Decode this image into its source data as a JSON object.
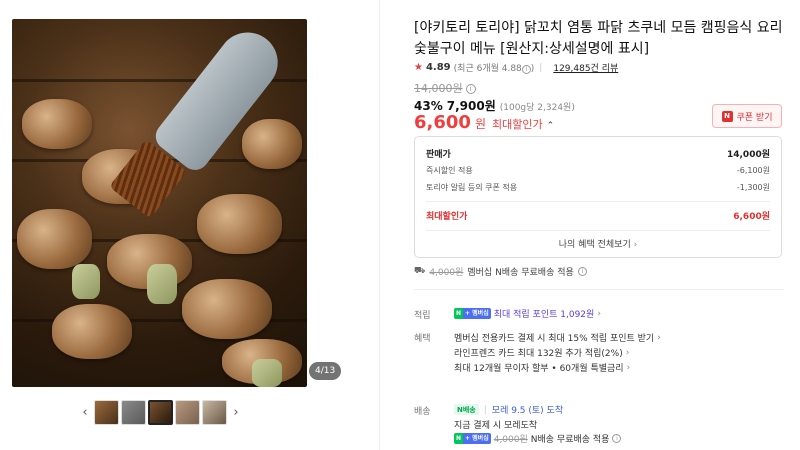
{
  "gallery": {
    "counter": "4/13",
    "prev_arrow": "‹",
    "next_arrow": "›",
    "thumbnails": [
      "thumb-1",
      "thumb-2",
      "thumb-3",
      "thumb-4",
      "thumb-5"
    ],
    "active_thumbnail": 3
  },
  "product": {
    "title": "[야키토리 토리야] 닭꼬치 염통 파닭 츠쿠네 모듬 캠핑음식 요리 숯불구이 메뉴 [원산지:상세설명에 표시]",
    "rating": "4.89",
    "rating_recent": "(최근 6개월 4.88",
    "rating_recent_close": ")",
    "review_count": "129,485건 리뷰",
    "original_price": "14,000원",
    "discount_rate": "43%",
    "discount_price": "7,900원",
    "unit_price": "(100g당 2,324원)",
    "final_price": "6,600",
    "final_unit": "원",
    "final_label": "최대할인가",
    "coupon_label": "쿠폰 받기"
  },
  "price_breakdown": {
    "sale_label": "판매가",
    "sale_value": "14,000원",
    "instant_label": "즉시할인 적용",
    "instant_value": "-6,100원",
    "coupon_label": "토리야 알림 등의 쿠폰 적용",
    "coupon_value": "-1,300원",
    "max_label": "최대할인가",
    "max_value": "6,600원",
    "more_label": "나의 혜택 전체보기"
  },
  "shipping": {
    "struck_fee": "4,000원",
    "text": "멤버십 N배송 무료배송 적용"
  },
  "benefits": {
    "points_label": "적립",
    "points_text": "최대 적립 포인트 1,092원",
    "benefit_label": "혜택",
    "benefit_lines": [
      "멤버십 전용카드 결제 시 최대 15% 적립 포인트 받기",
      "라인프렌즈 카드 최대 132원 추가 적립(2%)",
      "최대 12개월 무이자 할부 • 60개월 특별금리"
    ],
    "delivery_label": "배송",
    "delivery_badge": "N배송",
    "delivery_date": "모레 9.5 (토) 도착",
    "delivery_note": "지금 결제 시 모레도착",
    "delivery_fee_struck": "4,000원",
    "delivery_fee_text": "N배송 무료배송 적용",
    "badge_n": "N",
    "badge_plus": "+ 멤버십"
  },
  "colors": {
    "accent_red": "#f03e3e",
    "naver_green": "#03c75a",
    "point_purple": "#5c3ce0"
  }
}
